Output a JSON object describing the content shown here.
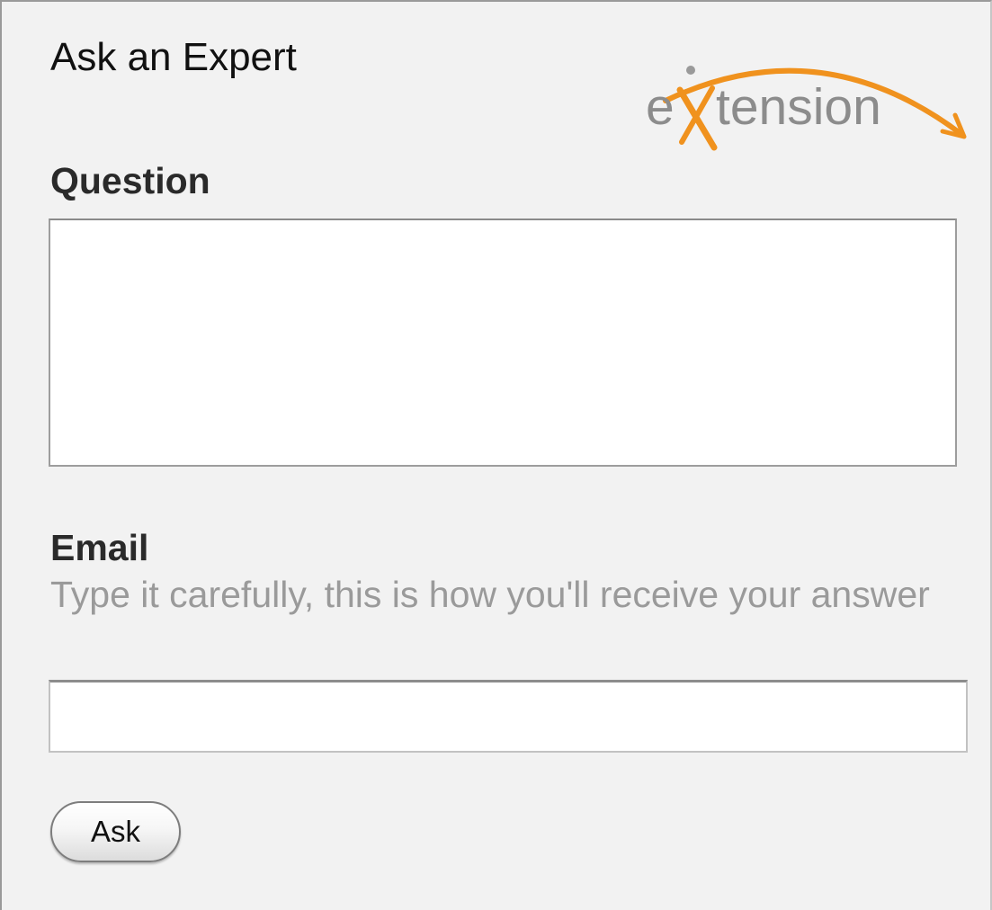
{
  "widget": {
    "title": "Ask an Expert",
    "logo": {
      "text": "eXtension",
      "text_color": "#8c8c8c",
      "accent_color": "#f0921e"
    }
  },
  "form": {
    "question_label": "Question",
    "question_value": "",
    "email_label": "Email",
    "email_hint": "Type it carefully, this is how you'll receive your answer",
    "email_value": "",
    "submit_label": "Ask"
  }
}
